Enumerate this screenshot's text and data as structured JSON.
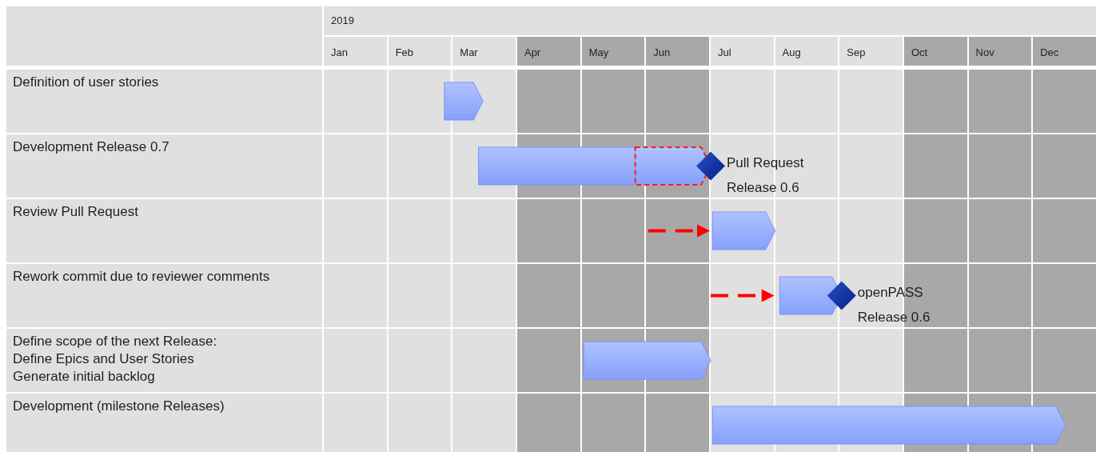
{
  "chart": {
    "year": "2019",
    "months": [
      {
        "label": "Jan",
        "shaded": false
      },
      {
        "label": "Feb",
        "shaded": false
      },
      {
        "label": "Mar",
        "shaded": false
      },
      {
        "label": "Apr",
        "shaded": true
      },
      {
        "label": "May",
        "shaded": true
      },
      {
        "label": "Jun",
        "shaded": true
      },
      {
        "label": "Jul",
        "shaded": false
      },
      {
        "label": "Aug",
        "shaded": false
      },
      {
        "label": "Sep",
        "shaded": false
      },
      {
        "label": "Oct",
        "shaded": true
      },
      {
        "label": "Nov",
        "shaded": true
      },
      {
        "label": "Dec",
        "shaded": true
      }
    ],
    "tasks": [
      {
        "label": "Definition of user stories"
      },
      {
        "label": "Development Release 0.7",
        "milestone": {
          "label": "Pull Request\nRelease 0.6"
        }
      },
      {
        "label": "Review Pull Request"
      },
      {
        "label": "Rework commit due to reviewer comments",
        "milestone": {
          "label": "openPASS\nRelease 0.6"
        }
      },
      {
        "label": "Define scope of the next Release:\nDefine Epics and User Stories\nGenerate initial backlog"
      },
      {
        "label": "Development (milestone Releases)"
      }
    ]
  }
}
